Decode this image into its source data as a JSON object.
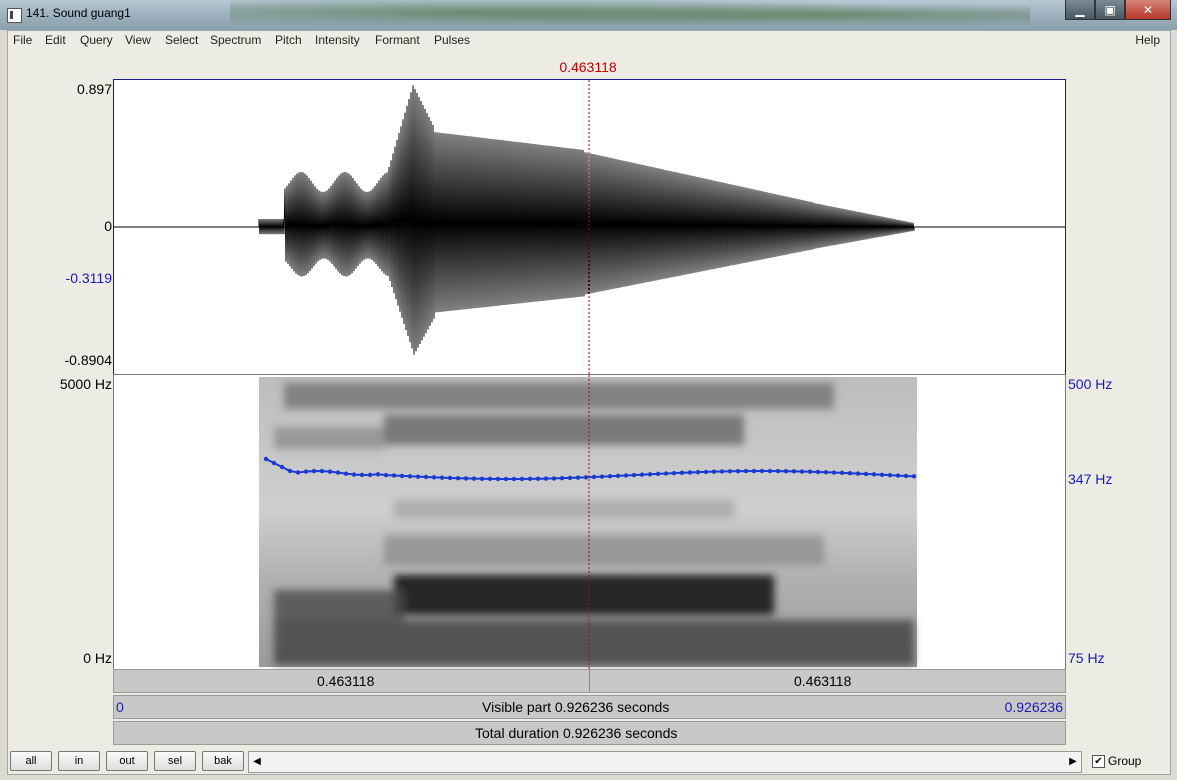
{
  "window": {
    "title": "141. Sound guang1",
    "minimize": "▁",
    "maximize": "▣",
    "close": "✕"
  },
  "menu": {
    "items": [
      "File",
      "Edit",
      "Query",
      "View",
      "Select",
      "Spectrum",
      "Pitch",
      "Intensity",
      "Formant",
      "Pulses"
    ],
    "help": "Help"
  },
  "cursor": {
    "time_label": "0.463118",
    "position_fraction": 0.5
  },
  "waveform": {
    "y_max": "0.897",
    "y_zero": "0",
    "y_cursor_value": "-0.3119",
    "y_min": "-0.8904"
  },
  "spectrogram": {
    "freq_max": "5000 Hz",
    "freq_min": "0 Hz",
    "pitch_max": "500 Hz",
    "pitch_cursor": "347 Hz",
    "pitch_min": "75 Hz"
  },
  "time_bars": {
    "left_segment": "0.463118",
    "right_segment": "0.463118",
    "visible_start": "0",
    "visible_label": "Visible part 0.926236 seconds",
    "visible_end": "0.926236",
    "total_label": "Total duration 0.926236 seconds"
  },
  "buttons": {
    "all": "all",
    "in": "in",
    "out": "out",
    "sel": "sel",
    "bak": "bak"
  },
  "scroll": {
    "left_arrow": "◀",
    "right_arrow": "▶"
  },
  "group": {
    "label": "Group",
    "checked": "✔"
  },
  "colors": {
    "cursor": "#c00000",
    "pitch": "#1a3ad0",
    "axis_blue": "#1a1ab8"
  }
}
